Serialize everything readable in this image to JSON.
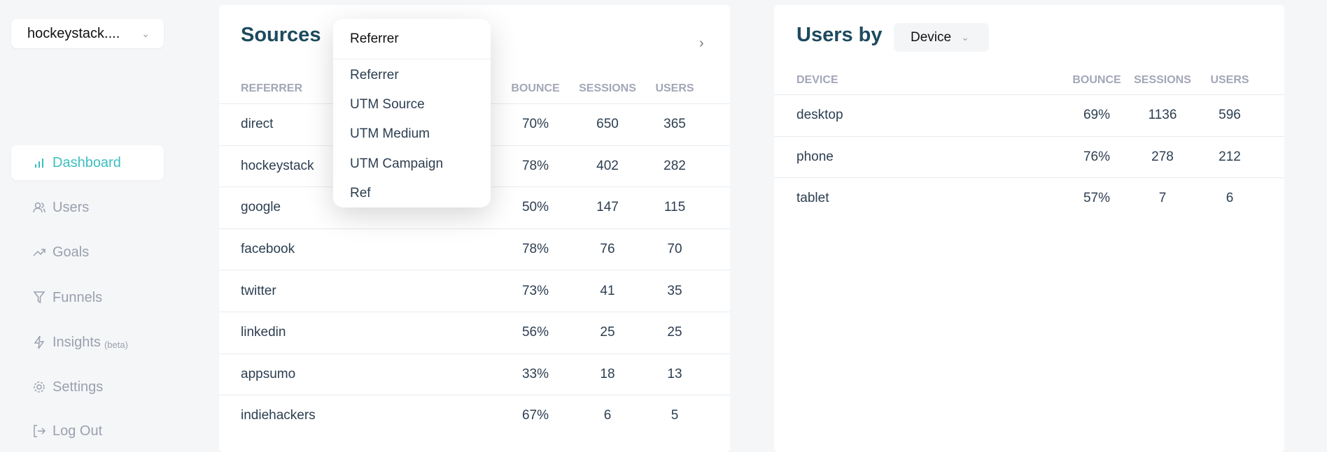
{
  "workspace": {
    "name": "hockeystack....",
    "icon": "chevron-down-icon"
  },
  "nav": [
    {
      "label": "Dashboard",
      "icon": "bar-chart-icon",
      "active": true
    },
    {
      "label": "Users",
      "icon": "users-icon"
    },
    {
      "label": "Goals",
      "icon": "trending-up-icon"
    },
    {
      "label": "Funnels",
      "icon": "filter-icon"
    },
    {
      "label": "Insights",
      "badge": "(beta)",
      "icon": "zap-icon"
    },
    {
      "label": "Settings",
      "icon": "gear-icon"
    },
    {
      "label": "Log Out",
      "icon": "logout-icon"
    }
  ],
  "sources": {
    "title": "Sources",
    "columns": [
      "REFERRER",
      "BOUNCE",
      "SESSIONS",
      "USERS"
    ],
    "rows": [
      [
        "direct",
        "70%",
        "650",
        "365"
      ],
      [
        "hockeystack",
        "78%",
        "402",
        "282"
      ],
      [
        "google",
        "50%",
        "147",
        "115"
      ],
      [
        "facebook",
        "78%",
        "76",
        "70"
      ],
      [
        "twitter",
        "73%",
        "41",
        "35"
      ],
      [
        "linkedin",
        "56%",
        "25",
        "25"
      ],
      [
        "appsumo",
        "33%",
        "18",
        "13"
      ],
      [
        "indiehackers",
        "67%",
        "6",
        "5"
      ]
    ],
    "dropdown": {
      "selected": "Referrer",
      "options": [
        "Referrer",
        "UTM Source",
        "UTM Medium",
        "UTM Campaign",
        "Ref"
      ]
    }
  },
  "users_by": {
    "title": "Users by",
    "selected": "Device",
    "columns": [
      "DEVICE",
      "BOUNCE",
      "SESSIONS",
      "USERS"
    ],
    "rows": [
      [
        "desktop",
        "69%",
        "1136",
        "596"
      ],
      [
        "phone",
        "76%",
        "278",
        "212"
      ],
      [
        "tablet",
        "57%",
        "7",
        "6"
      ]
    ]
  },
  "colors": {
    "accent": "#3bbfbf",
    "title": "#1d4a5e",
    "muted": "#9aa0ae"
  }
}
